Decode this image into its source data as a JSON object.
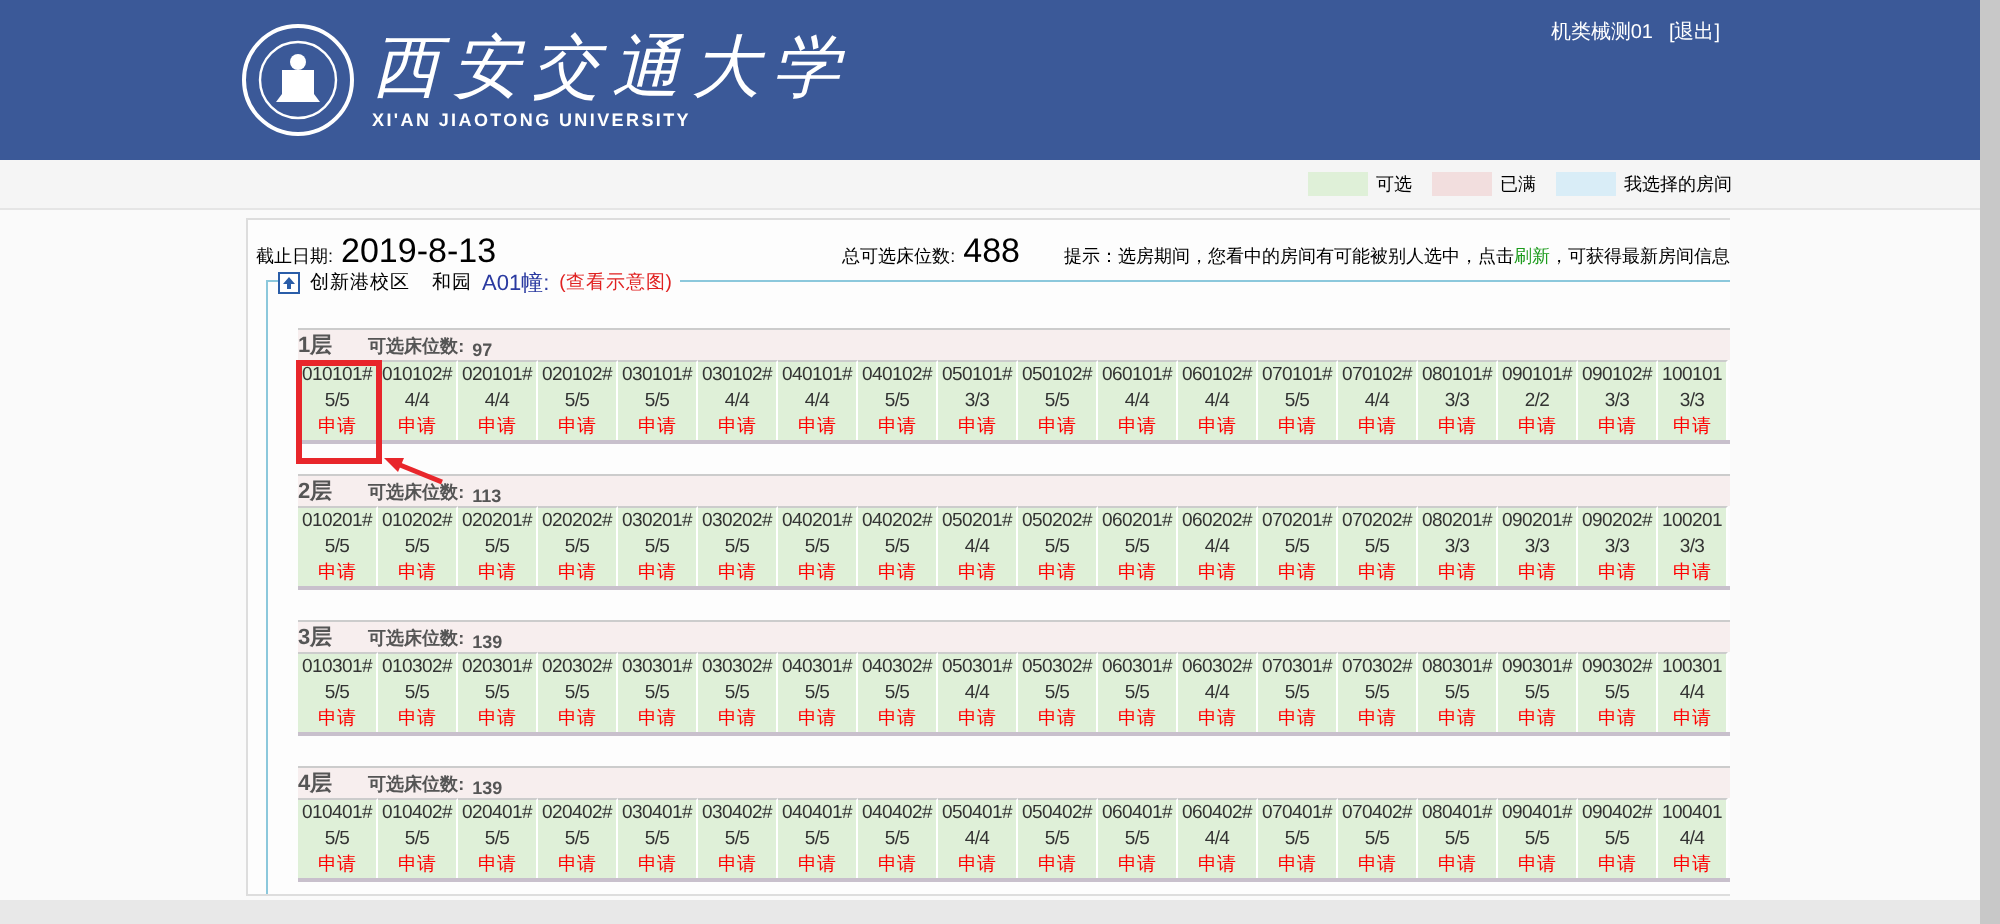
{
  "header": {
    "university_cn": "西安交通大学",
    "university_en": "XI'AN JIAOTONG UNIVERSITY",
    "user": "机类械测01",
    "logout": "[退出]"
  },
  "legend": [
    {
      "label": "可选",
      "color": "#dff0d8"
    },
    {
      "label": "已满",
      "color": "#f2dede"
    },
    {
      "label": "我选择的房间",
      "color": "#d9edf7"
    }
  ],
  "info": {
    "deadline_label": "截止日期:",
    "deadline": "2019-8-13",
    "total_label": "总可选床位数:",
    "total": "488",
    "tip_before": "提示：选房期间，您看中的房间有可能被别人选中，点击",
    "tip_link": "刷新",
    "tip_after": "，可获得最新房间信息"
  },
  "building": {
    "campus": "创新港校区",
    "yard": "和园",
    "name": "A01幢:",
    "view_link": "(查看示意图)"
  },
  "floors": [
    {
      "name": "1层",
      "available_label": "可选床位数:",
      "available": "97",
      "rooms": [
        {
          "id": "010101#",
          "beds": "5/5",
          "action": "申请"
        },
        {
          "id": "010102#",
          "beds": "4/4",
          "action": "申请"
        },
        {
          "id": "020101#",
          "beds": "4/4",
          "action": "申请"
        },
        {
          "id": "020102#",
          "beds": "5/5",
          "action": "申请"
        },
        {
          "id": "030101#",
          "beds": "5/5",
          "action": "申请"
        },
        {
          "id": "030102#",
          "beds": "4/4",
          "action": "申请"
        },
        {
          "id": "040101#",
          "beds": "4/4",
          "action": "申请"
        },
        {
          "id": "040102#",
          "beds": "5/5",
          "action": "申请"
        },
        {
          "id": "050101#",
          "beds": "3/3",
          "action": "申请"
        },
        {
          "id": "050102#",
          "beds": "5/5",
          "action": "申请"
        },
        {
          "id": "060101#",
          "beds": "4/4",
          "action": "申请"
        },
        {
          "id": "060102#",
          "beds": "4/4",
          "action": "申请"
        },
        {
          "id": "070101#",
          "beds": "5/5",
          "action": "申请"
        },
        {
          "id": "070102#",
          "beds": "4/4",
          "action": "申请"
        },
        {
          "id": "080101#",
          "beds": "3/3",
          "action": "申请"
        },
        {
          "id": "090101#",
          "beds": "2/2",
          "action": "申请"
        },
        {
          "id": "090102#",
          "beds": "3/3",
          "action": "申请"
        },
        {
          "id": "100101",
          "beds": "3/3",
          "action": "申请"
        }
      ]
    },
    {
      "name": "2层",
      "available_label": "可选床位数:",
      "available": "113",
      "rooms": [
        {
          "id": "010201#",
          "beds": "5/5",
          "action": "申请"
        },
        {
          "id": "010202#",
          "beds": "5/5",
          "action": "申请"
        },
        {
          "id": "020201#",
          "beds": "5/5",
          "action": "申请"
        },
        {
          "id": "020202#",
          "beds": "5/5",
          "action": "申请"
        },
        {
          "id": "030201#",
          "beds": "5/5",
          "action": "申请"
        },
        {
          "id": "030202#",
          "beds": "5/5",
          "action": "申请"
        },
        {
          "id": "040201#",
          "beds": "5/5",
          "action": "申请"
        },
        {
          "id": "040202#",
          "beds": "5/5",
          "action": "申请"
        },
        {
          "id": "050201#",
          "beds": "4/4",
          "action": "申请"
        },
        {
          "id": "050202#",
          "beds": "5/5",
          "action": "申请"
        },
        {
          "id": "060201#",
          "beds": "5/5",
          "action": "申请"
        },
        {
          "id": "060202#",
          "beds": "4/4",
          "action": "申请"
        },
        {
          "id": "070201#",
          "beds": "5/5",
          "action": "申请"
        },
        {
          "id": "070202#",
          "beds": "5/5",
          "action": "申请"
        },
        {
          "id": "080201#",
          "beds": "3/3",
          "action": "申请"
        },
        {
          "id": "090201#",
          "beds": "3/3",
          "action": "申请"
        },
        {
          "id": "090202#",
          "beds": "3/3",
          "action": "申请"
        },
        {
          "id": "100201",
          "beds": "3/3",
          "action": "申请"
        }
      ]
    },
    {
      "name": "3层",
      "available_label": "可选床位数:",
      "available": "139",
      "rooms": [
        {
          "id": "010301#",
          "beds": "5/5",
          "action": "申请"
        },
        {
          "id": "010302#",
          "beds": "5/5",
          "action": "申请"
        },
        {
          "id": "020301#",
          "beds": "5/5",
          "action": "申请"
        },
        {
          "id": "020302#",
          "beds": "5/5",
          "action": "申请"
        },
        {
          "id": "030301#",
          "beds": "5/5",
          "action": "申请"
        },
        {
          "id": "030302#",
          "beds": "5/5",
          "action": "申请"
        },
        {
          "id": "040301#",
          "beds": "5/5",
          "action": "申请"
        },
        {
          "id": "040302#",
          "beds": "5/5",
          "action": "申请"
        },
        {
          "id": "050301#",
          "beds": "4/4",
          "action": "申请"
        },
        {
          "id": "050302#",
          "beds": "5/5",
          "action": "申请"
        },
        {
          "id": "060301#",
          "beds": "5/5",
          "action": "申请"
        },
        {
          "id": "060302#",
          "beds": "4/4",
          "action": "申请"
        },
        {
          "id": "070301#",
          "beds": "5/5",
          "action": "申请"
        },
        {
          "id": "070302#",
          "beds": "5/5",
          "action": "申请"
        },
        {
          "id": "080301#",
          "beds": "5/5",
          "action": "申请"
        },
        {
          "id": "090301#",
          "beds": "5/5",
          "action": "申请"
        },
        {
          "id": "090302#",
          "beds": "5/5",
          "action": "申请"
        },
        {
          "id": "100301",
          "beds": "4/4",
          "action": "申请"
        }
      ]
    },
    {
      "name": "4层",
      "available_label": "可选床位数:",
      "available": "139",
      "rooms": [
        {
          "id": "010401#",
          "beds": "5/5",
          "action": "申请"
        },
        {
          "id": "010402#",
          "beds": "5/5",
          "action": "申请"
        },
        {
          "id": "020401#",
          "beds": "5/5",
          "action": "申请"
        },
        {
          "id": "020402#",
          "beds": "5/5",
          "action": "申请"
        },
        {
          "id": "030401#",
          "beds": "5/5",
          "action": "申请"
        },
        {
          "id": "030402#",
          "beds": "5/5",
          "action": "申请"
        },
        {
          "id": "040401#",
          "beds": "5/5",
          "action": "申请"
        },
        {
          "id": "040402#",
          "beds": "5/5",
          "action": "申请"
        },
        {
          "id": "050401#",
          "beds": "4/4",
          "action": "申请"
        },
        {
          "id": "050402#",
          "beds": "5/5",
          "action": "申请"
        },
        {
          "id": "060401#",
          "beds": "5/5",
          "action": "申请"
        },
        {
          "id": "060402#",
          "beds": "4/4",
          "action": "申请"
        },
        {
          "id": "070401#",
          "beds": "5/5",
          "action": "申请"
        },
        {
          "id": "070402#",
          "beds": "5/5",
          "action": "申请"
        },
        {
          "id": "080401#",
          "beds": "5/5",
          "action": "申请"
        },
        {
          "id": "090401#",
          "beds": "5/5",
          "action": "申请"
        },
        {
          "id": "090402#",
          "beds": "5/5",
          "action": "申请"
        },
        {
          "id": "100401",
          "beds": "4/4",
          "action": "申请"
        }
      ]
    }
  ]
}
